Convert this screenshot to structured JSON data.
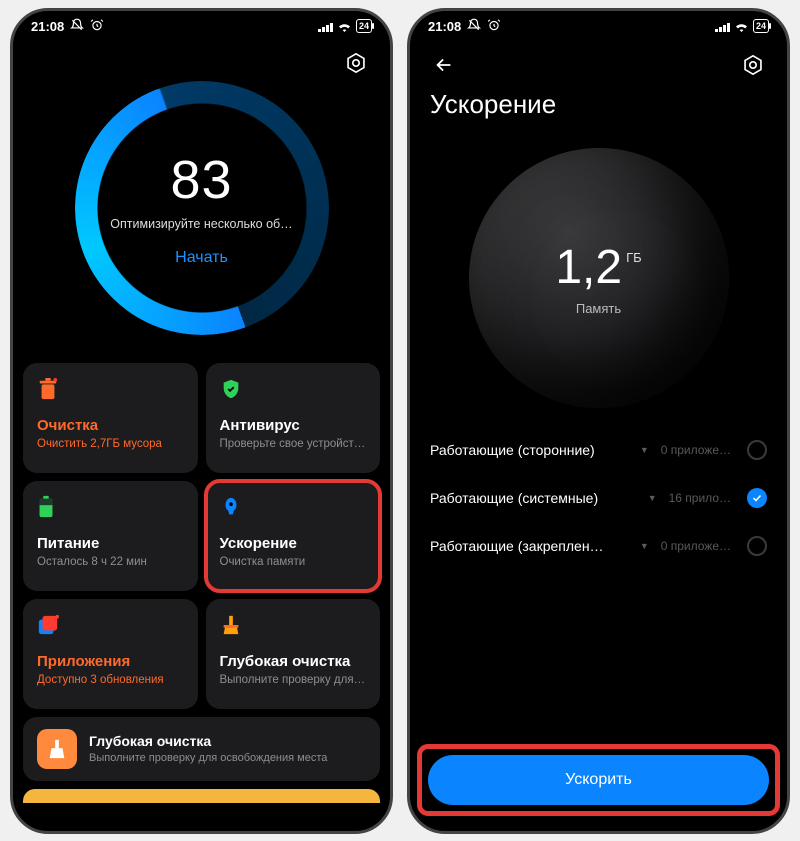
{
  "status": {
    "time": "21:08",
    "battery": "24"
  },
  "left": {
    "score": "83",
    "score_sub": "Оптимизируйте несколько об…",
    "start": "Начать",
    "tiles": [
      {
        "title": "Очистка",
        "sub": "Очистить 2,7ГБ мусора"
      },
      {
        "title": "Антивирус",
        "sub": "Проверьте свое устройст…"
      },
      {
        "title": "Питание",
        "sub": "Осталось 8 ч 22 мин"
      },
      {
        "title": "Ускорение",
        "sub": "Очистка памяти"
      },
      {
        "title": "Приложения",
        "sub": "Доступно 3 обновления"
      },
      {
        "title": "Глубокая очистка",
        "sub": "Выполните проверку для…"
      }
    ],
    "banner": {
      "title": "Глубокая очистка",
      "sub": "Выполните проверку для освобождения места"
    }
  },
  "right": {
    "title": "Ускорение",
    "mem_value": "1,2",
    "mem_unit": "ГБ",
    "mem_label": "Память",
    "rows": [
      {
        "label": "Работающие (сторонние)",
        "count": "0 приложе…",
        "checked": false
      },
      {
        "label": "Работающие (системные)",
        "count": "16 прило…",
        "checked": true
      },
      {
        "label": "Работающие (закреплен…",
        "count": "0 приложе…",
        "checked": false
      }
    ],
    "button": "Ускорить"
  }
}
